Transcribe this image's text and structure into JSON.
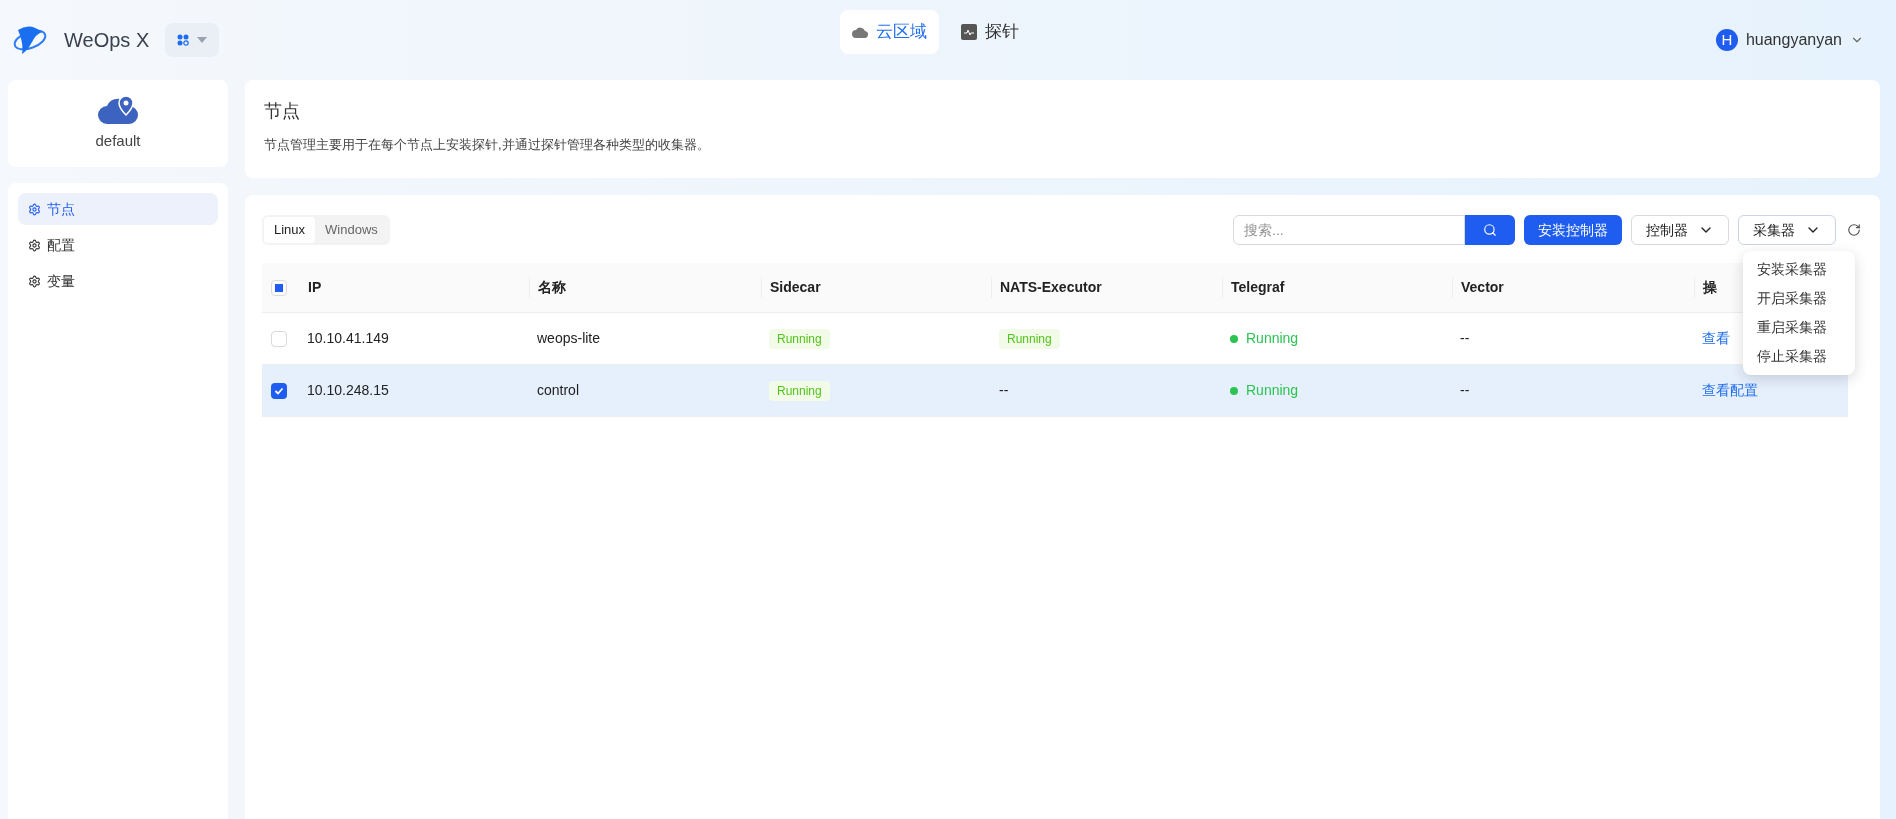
{
  "app": {
    "name": "WeOps X"
  },
  "top_nav": [
    {
      "label": "云区域",
      "selected": true
    },
    {
      "label": "探针",
      "selected": false
    }
  ],
  "user": {
    "initial": "H",
    "name": "huangyanyan"
  },
  "sidebar": {
    "cloud": "default",
    "items": [
      {
        "label": "节点",
        "selected": true
      },
      {
        "label": "配置",
        "selected": false
      },
      {
        "label": "变量",
        "selected": false
      }
    ]
  },
  "header": {
    "title": "节点",
    "description": "节点管理主要用于在每个节点上安装探针,并通过探针管理各种类型的收集器。"
  },
  "os_tabs": [
    {
      "label": "Linux",
      "selected": true
    },
    {
      "label": "Windows",
      "selected": false
    }
  ],
  "search": {
    "placeholder": "搜索..."
  },
  "buttons": {
    "install": "安装控制器",
    "controller": "控制器",
    "collector": "采集器"
  },
  "collector_menu": [
    "安装采集器",
    "开启采集器",
    "重启采集器",
    "停止采集器"
  ],
  "table": {
    "all_indeterminate": true,
    "columns": [
      "IP",
      "名称",
      "Sidecar",
      "NATS-Executor",
      "Telegraf",
      "Vector",
      "操"
    ],
    "rows": [
      {
        "selected": false,
        "cells": [
          {
            "kind": "text",
            "text": "10.10.41.149"
          },
          {
            "kind": "text",
            "text": "weops-lite"
          },
          {
            "kind": "tag",
            "text": "Running"
          },
          {
            "kind": "tag",
            "text": "Running"
          },
          {
            "kind": "dot",
            "text": "Running"
          },
          {
            "kind": "text",
            "text": "--"
          },
          {
            "kind": "link",
            "text": "查看"
          }
        ]
      },
      {
        "selected": true,
        "cells": [
          {
            "kind": "text",
            "text": "10.10.248.15"
          },
          {
            "kind": "text",
            "text": "control"
          },
          {
            "kind": "tag",
            "text": "Running"
          },
          {
            "kind": "text",
            "text": "--"
          },
          {
            "kind": "dot",
            "text": "Running"
          },
          {
            "kind": "text",
            "text": "--"
          },
          {
            "kind": "link",
            "text": "查看配置"
          }
        ]
      }
    ]
  }
}
